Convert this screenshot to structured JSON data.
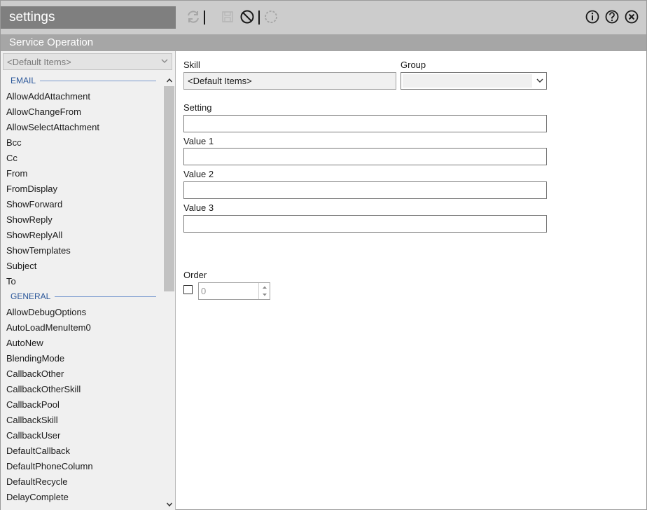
{
  "window": {
    "title": "settings",
    "section_title": "Service Operation"
  },
  "toolbar": {
    "refresh_icon": "refresh-icon",
    "save_icon": "save-icon",
    "cancel_icon": "cancel-icon",
    "busy_icon": "loading-icon",
    "info_icon": "info-icon",
    "help_icon": "help-icon",
    "close_icon": "close-icon"
  },
  "left": {
    "skill_select_value": "<Default Items>",
    "groups": [
      {
        "name": "EMAIL",
        "items": [
          "AllowAddAttachment",
          "AllowChangeFrom",
          "AllowSelectAttachment",
          "Bcc",
          "Cc",
          "From",
          "FromDisplay",
          "ShowForward",
          "ShowReply",
          "ShowReplyAll",
          "ShowTemplates",
          "Subject",
          "To"
        ]
      },
      {
        "name": "GENERAL",
        "items": [
          "AllowDebugOptions",
          "AutoLoadMenuItem0",
          "AutoNew",
          "BlendingMode",
          "CallbackOther",
          "CallbackOtherSkill",
          "CallbackPool",
          "CallbackSkill",
          "CallbackUser",
          "DefaultCallback",
          "DefaultPhoneColumn",
          "DefaultRecycle",
          "DelayComplete"
        ]
      }
    ]
  },
  "form": {
    "skill_label": "Skill",
    "skill_value": "<Default Items>",
    "group_label": "Group",
    "group_value": "",
    "setting_label": "Setting",
    "setting_value": "",
    "value1_label": "Value 1",
    "value1_value": "",
    "value2_label": "Value 2",
    "value2_value": "",
    "value3_label": "Value 3",
    "value3_value": "",
    "order_label": "Order",
    "order_checked": false,
    "order_value": "0"
  },
  "colors": {
    "titlebar": "#cccccc",
    "title_block": "#7f7f7f",
    "section_header": "#a6a6a6",
    "group_header_text": "#2b579a",
    "panel_bg": "#f0f0f0"
  }
}
